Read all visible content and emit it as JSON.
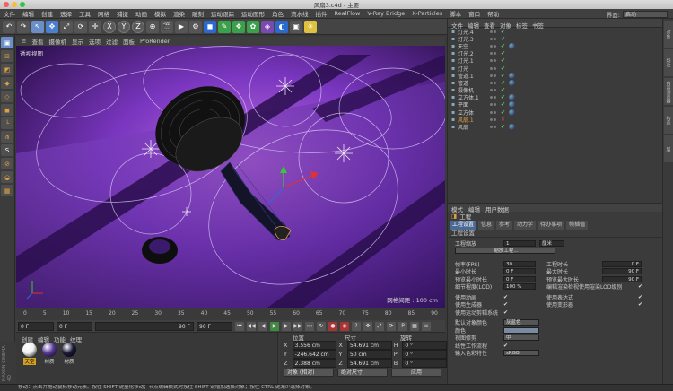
{
  "window": {
    "title": "风扇3.c4d - 主要"
  },
  "menu": [
    "文件",
    "编辑",
    "创建",
    "选择",
    "工具",
    "网格",
    "捕捉",
    "动画",
    "模拟",
    "渲染",
    "雕刻",
    "运动跟踪",
    "运动图形",
    "角色",
    "流水线",
    "插件",
    "RealFlow",
    "V-Ray Bridge",
    "X-Particles",
    "脚本",
    "窗口",
    "帮助"
  ],
  "interface": {
    "label": "界面:",
    "value": "启动"
  },
  "toolbar": {
    "axes": [
      "X",
      "Y",
      "Z"
    ]
  },
  "viewport": {
    "menu": [
      "查看",
      "摄像机",
      "显示",
      "选项",
      "过滤",
      "面板",
      "ProRender"
    ],
    "label": "透视视图",
    "grid_info": "网格间距 : 100 cm"
  },
  "timeline": {
    "ticks": [
      "0",
      "5",
      "10",
      "15",
      "20",
      "25",
      "30",
      "35",
      "40",
      "45",
      "50",
      "55",
      "60",
      "65",
      "70",
      "75",
      "80",
      "85",
      "90"
    ],
    "frame_field": "0 F",
    "start_field": "0 F",
    "end_field": "90 F",
    "end_field2": "90 F"
  },
  "material_panel": {
    "menu": [
      "创建",
      "编辑",
      "功能",
      "纹理"
    ],
    "materials": [
      {
        "label": "天空",
        "color": "#f0f0f0"
      },
      {
        "label": "材质",
        "color": "#5a3a9a"
      },
      {
        "label": "材质",
        "color": "#1a1a3a"
      }
    ]
  },
  "coords": {
    "headers": [
      "位置",
      "尺寸",
      "旋转"
    ],
    "rows": [
      {
        "axis": "X",
        "pos": "3.556 cm",
        "size_axis": "X",
        "size": "54.691 cm",
        "rot_axis": "H",
        "rot": "0 °"
      },
      {
        "axis": "Y",
        "pos": "-246.642 cm",
        "size_axis": "Y",
        "size": "50 cm",
        "rot_axis": "P",
        "rot": "0 °"
      },
      {
        "axis": "Z",
        "pos": "2.388 cm",
        "size_axis": "Z",
        "size": "54.691 cm",
        "rot_axis": "B",
        "rot": "0 °"
      }
    ],
    "mode1": "对象 (相对)",
    "mode2": "绝对尺寸",
    "apply": "应用"
  },
  "object_panel": {
    "menu": [
      "文件",
      "编辑",
      "查看",
      "对象",
      "标签",
      "书签"
    ],
    "objects": [
      {
        "name": "灯光.4",
        "status": "check",
        "tag": false
      },
      {
        "name": "灯光.3",
        "status": "check",
        "tag": false
      },
      {
        "name": "天空",
        "status": "check",
        "tag": true
      },
      {
        "name": "灯光.2",
        "status": "check",
        "tag": false
      },
      {
        "name": "灯光.1",
        "status": "check",
        "tag": false
      },
      {
        "name": "灯光",
        "status": "check",
        "tag": false
      },
      {
        "name": "管道.1",
        "status": "check",
        "tag": true
      },
      {
        "name": "管道",
        "status": "check",
        "tag": true
      },
      {
        "name": "摄像机",
        "status": "check",
        "tag": false
      },
      {
        "name": "立方体.1",
        "status": "check",
        "tag": true
      },
      {
        "name": "平面",
        "status": "check",
        "tag": true
      },
      {
        "name": "立方体",
        "status": "check",
        "tag": true
      },
      {
        "name": "风扇.1",
        "status": "x",
        "tag": false
      },
      {
        "name": "风扇",
        "status": "check",
        "tag": true
      }
    ]
  },
  "side_tabs": [
    "对象",
    "场次",
    "内容浏览器",
    "构造",
    "层"
  ],
  "attributes": {
    "menu": [
      "模式",
      "编辑",
      "用户数据"
    ],
    "title": "工程",
    "tabs": [
      "工程设置",
      "信息",
      "参考",
      "动力学",
      "待办事项",
      "帧插值"
    ],
    "section": "工程设置",
    "scale_label": "工程缩放",
    "scale_value": "1",
    "scale_unit": "厘米",
    "scale_btn": "缩放工程...",
    "fps_label": "帧率(FPS)",
    "fps": "30",
    "min_time_label": "最小时长",
    "min_time": "0 F",
    "preview_min_label": "预览最小时长",
    "preview_min": "0 F",
    "lod_label": "细节程度(LOD)",
    "lod": "100 %",
    "duration_label": "工程时长",
    "duration": "0 F",
    "max_time_label": "最大时长",
    "max_time": "90 F",
    "preview_max_label": "预览最大时长",
    "preview_max": "90 F",
    "editor_lod_label": "编辑渲染检视使用渲染LOD级别",
    "use_anim_label": "使用动画",
    "use_gen_label": "使用生成器",
    "use_motion_label": "使用运动剪辑系统",
    "use_expr_label": "使用表达式",
    "use_deform_label": "使用变形器",
    "default_color_label": "默认对象颜色",
    "default_color": "灰蓝色",
    "color_label": "颜色",
    "view_clip_label": "视图修剪",
    "view_clip": "中",
    "linear_label": "线性工作流程",
    "input_color_label": "输入色彩特性",
    "input_color": "sRGB"
  },
  "status": "移动：点击并拖动鼠标移动元素。按住 SHIFT 键量化移动；节点编辑模式时按住 SHIFT 键增加选择对象；按住 CTRL 键减少选择对象。"
}
